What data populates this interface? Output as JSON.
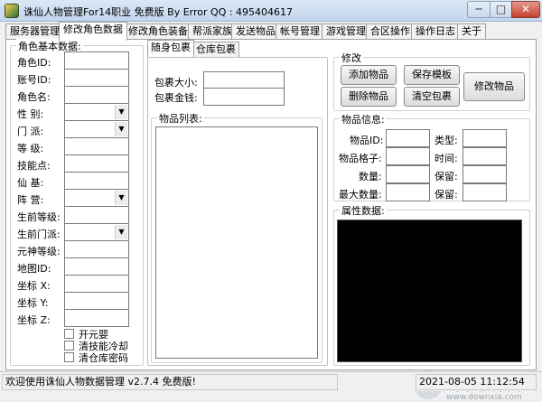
{
  "window": {
    "title": "诛仙人物管理For14职业 免费版 By Error QQ : 495404617",
    "min": "─",
    "max": "□",
    "close": "✕"
  },
  "tabs": [
    "服务器管理",
    "修改角色数据",
    "修改角色装备",
    "帮派家族",
    "发送物品",
    "帐号管理",
    "游戏管理",
    "合区操作",
    "操作日志",
    "关于"
  ],
  "active_tab": 1,
  "basic": {
    "title": "角色基本数据:",
    "fields": [
      "角色ID:",
      "账号ID:",
      "角色名:",
      "性  别:",
      "门  派:",
      "等  级:",
      "技能点:",
      "仙  基:",
      "阵  营:",
      "生前等级:",
      "生前门派:",
      "元神等级:",
      "地图ID:",
      "坐标 X:",
      "坐标 Y:",
      "坐标 Z:"
    ],
    "checkboxes": [
      "开元婴",
      "清技能冷却",
      "清仓库密码"
    ]
  },
  "bag": {
    "subtabs": [
      "随身包裹",
      "仓库包裹"
    ],
    "size_label": "包裹大小:",
    "money_label": "包裹金钱:",
    "list_title": "物品列表:"
  },
  "modify": {
    "title": "修改",
    "add": "添加物品",
    "save_template": "保存模板",
    "delete": "删除物品",
    "clear_bag": "清空包裹",
    "modify": "修改物品"
  },
  "item_info": {
    "title": "物品信息:",
    "labels_left": [
      "物品ID:",
      "物品格子:",
      "数量:",
      "最大数量:"
    ],
    "labels_right": [
      "类型:",
      "时间:",
      "保留:",
      "保留:"
    ]
  },
  "attr": {
    "title": "属性数据:"
  },
  "status": {
    "message": "欢迎使用诛仙人物数据管理 v2.7.4 免费版!",
    "datetime": "2021-08-05 11:12:54"
  },
  "watermark": {
    "text": "当下软件园",
    "url": "www.downxia.com"
  },
  "colors": {
    "title_bar": "#c3d6ee",
    "attr_panel": "#000000",
    "close_button": "#c8412f"
  }
}
